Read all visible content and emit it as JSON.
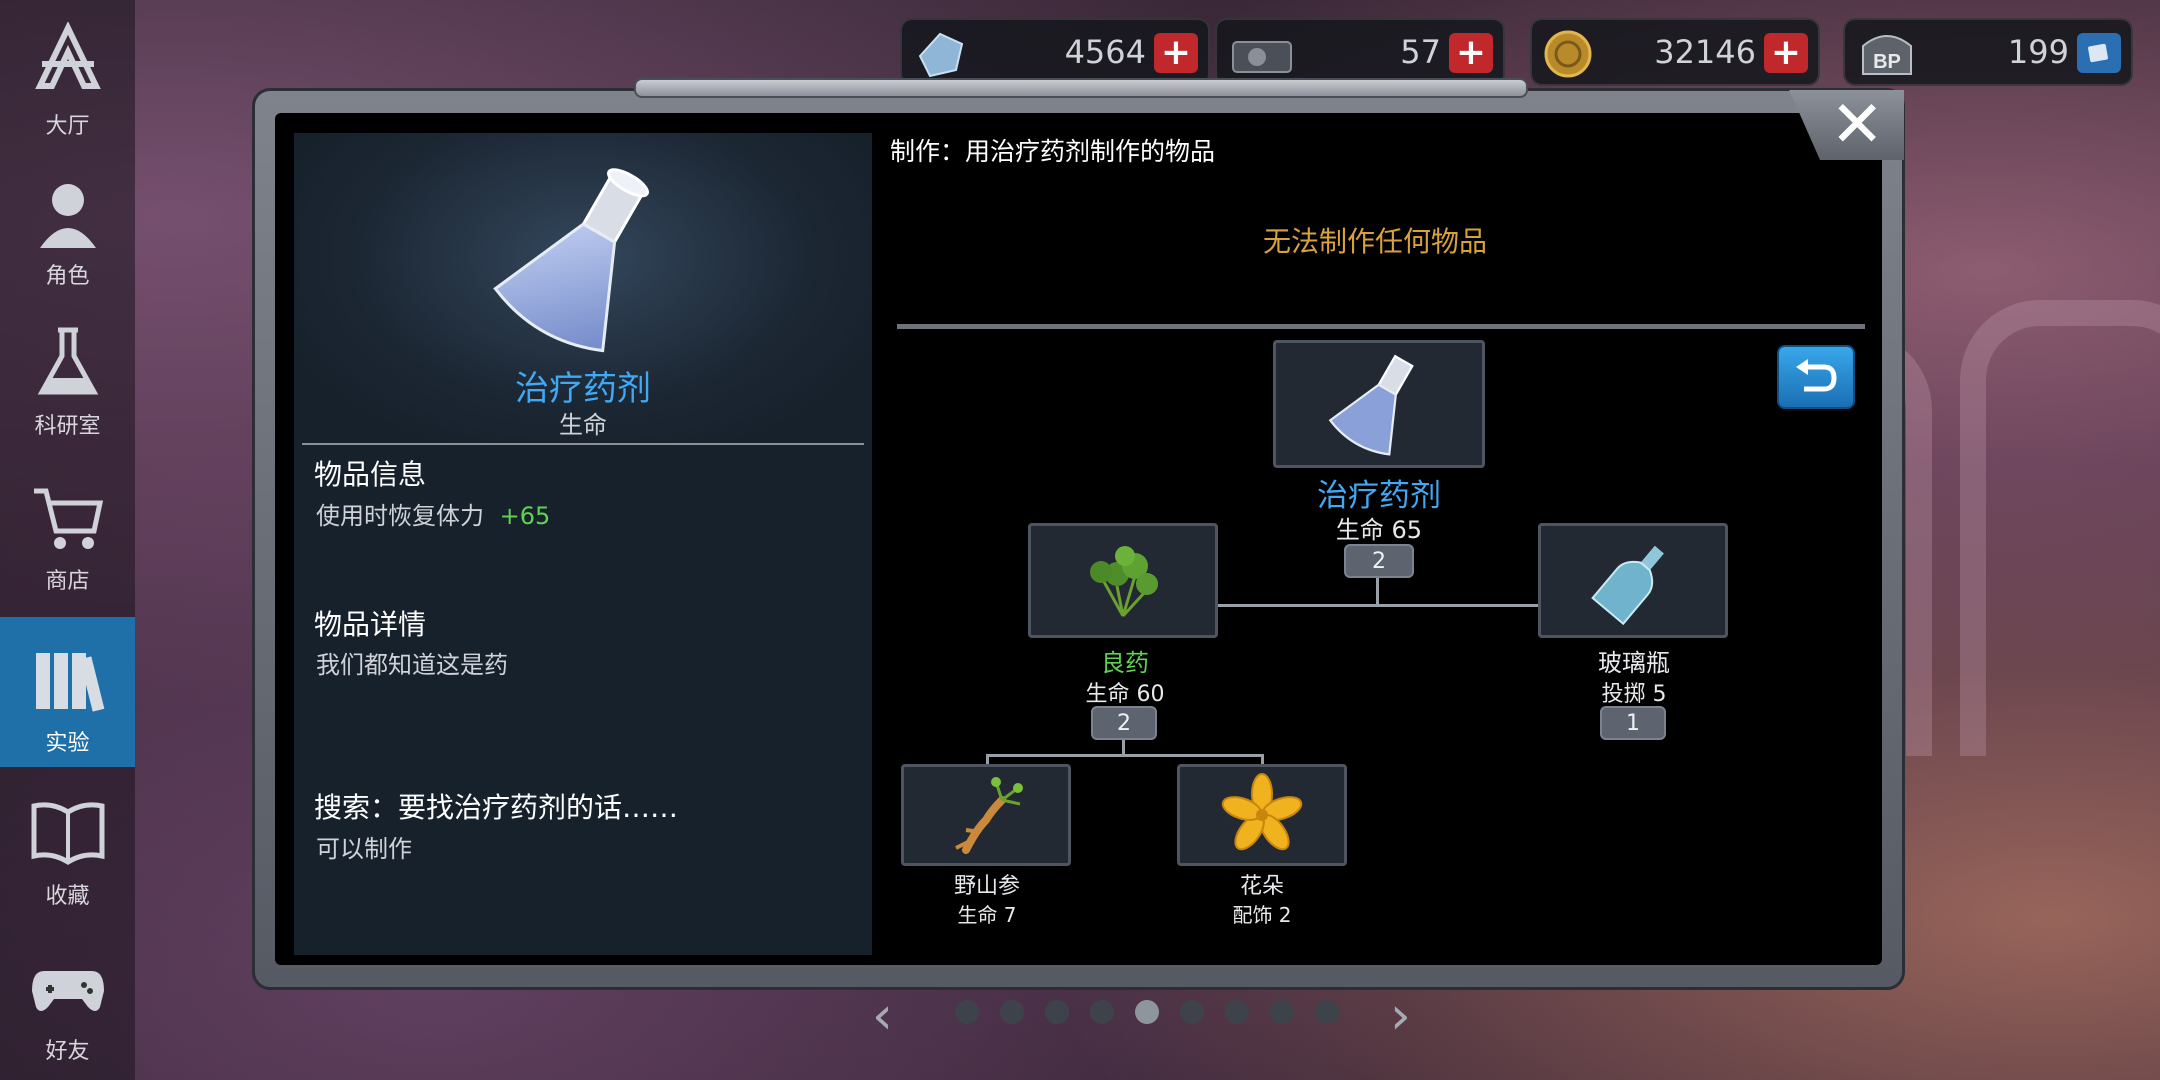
{
  "sidebar": {
    "items": [
      {
        "label": "大厅",
        "icon": "lobby-logo-icon",
        "active": false
      },
      {
        "label": "角色",
        "icon": "character-icon",
        "active": false
      },
      {
        "label": "科研室",
        "icon": "flask-icon",
        "active": false
      },
      {
        "label": "商店",
        "icon": "cart-icon",
        "active": false
      },
      {
        "label": "实验",
        "icon": "books-icon",
        "active": true
      },
      {
        "label": "收藏",
        "icon": "open-book-icon",
        "active": false
      },
      {
        "label": "好友",
        "icon": "gamepad-icon",
        "active": false
      }
    ]
  },
  "currency": [
    {
      "icon": "crystal-icon",
      "value": "4564",
      "button": "plus-icon"
    },
    {
      "icon": "device-icon",
      "value": "57",
      "button": "plus-icon"
    },
    {
      "icon": "coin-icon",
      "value": "32146",
      "button": "plus-icon"
    },
    {
      "icon": "bp-icon",
      "value": "199",
      "button": "card-icon"
    }
  ],
  "item": {
    "name": "治疗药剂",
    "type": "生命",
    "info_title": "物品信息",
    "info_text": "使用时恢复体力",
    "info_bonus": "+65",
    "detail_title": "物品详情",
    "detail_text": "我们都知道这是药",
    "search_title": "搜索：要找治疗药剂的话……",
    "search_text": "可以制作"
  },
  "craft": {
    "title": "制作：用治疗药剂制作的物品",
    "empty_message": "无法制作任何物品"
  },
  "tree": {
    "root": {
      "name": "治疗药剂",
      "stat": "生命 65",
      "count": "2",
      "icon": "flask-icon"
    },
    "left": {
      "name": "良药",
      "stat": "生命 60",
      "count": "2",
      "icon": "herb-icon"
    },
    "right": {
      "name": "玻璃瓶",
      "stat": "投掷 5",
      "count": "1",
      "icon": "glass-bottle-icon"
    },
    "leaf1": {
      "name": "野山参",
      "stat": "生命 7",
      "icon": "ginseng-icon"
    },
    "leaf2": {
      "name": "花朵",
      "stat": "配饰 2",
      "icon": "flower-icon"
    }
  },
  "pager": {
    "total_pages": 9,
    "current_page": 5
  },
  "colors": {
    "accent_blue": "#3fa9f5",
    "positive_green": "#5fd24f",
    "warning_gold": "#d9a13a",
    "active_nav": "#1f6fa8"
  }
}
